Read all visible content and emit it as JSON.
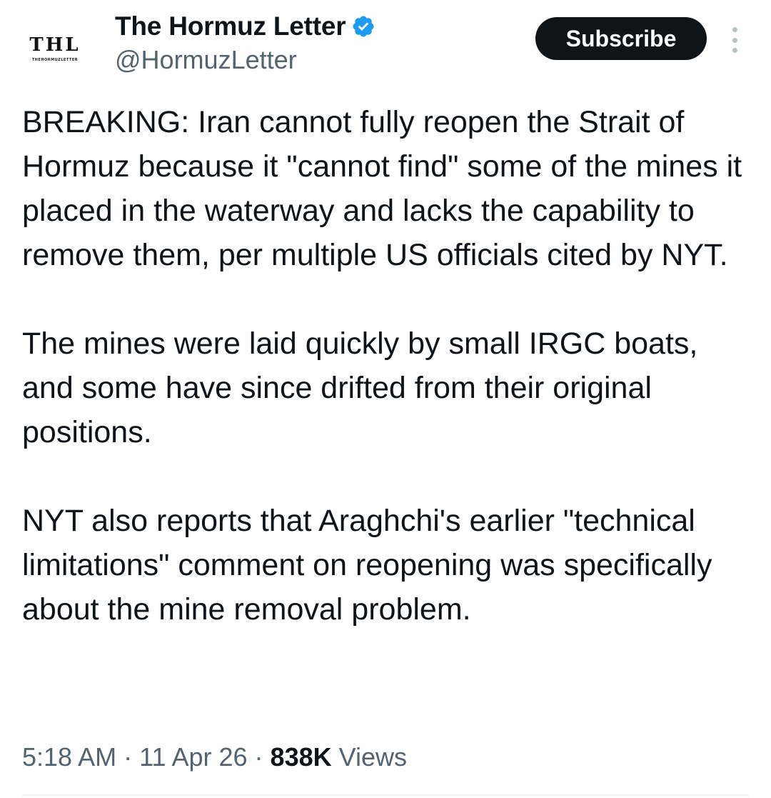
{
  "author": {
    "display_name": "The Hormuz Letter",
    "handle": "@HormuzLetter",
    "avatar_text": "THL",
    "avatar_subtext": "THEHORMUZLETTER",
    "verified": true,
    "verified_color": "#1d9bf0"
  },
  "actions": {
    "subscribe_label": "Subscribe",
    "more_icon": "more-vertical-icon"
  },
  "tweet": {
    "paragraphs": [
      "BREAKING: Iran cannot fully reopen the Strait of Hormuz because it \"cannot find\" some of the mines it placed in the waterway and lacks the capability to remove them, per multiple US officials cited by NYT.",
      "The mines were laid quickly by small IRGC boats, and some have since drifted from their original positions.",
      "NYT also reports that Araghchi's earlier \"technical limitations\" comment on reopening was specifically about the mine removal problem."
    ]
  },
  "meta": {
    "time": "5:18 AM",
    "separator": " · ",
    "date": "11 Apr 26",
    "views_count": "838K",
    "views_label": "Views"
  },
  "colors": {
    "text": "#0f1419",
    "secondary": "#536471",
    "button_bg": "#0f1419",
    "button_text": "#ffffff"
  }
}
